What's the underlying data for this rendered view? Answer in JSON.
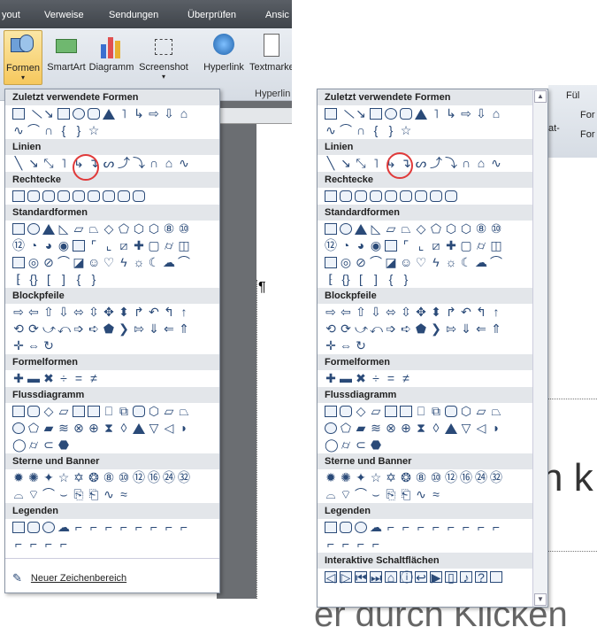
{
  "ribbon": {
    "tabs": [
      "yout",
      "Verweise",
      "Sendungen",
      "Überprüfen",
      "Ansic"
    ],
    "buttons": [
      "Formen",
      "SmartArt",
      "Diagramm",
      "Screenshot",
      "Hyperlink",
      "Textmarke"
    ],
    "group_label": "Hyperlin"
  },
  "left_panel": {
    "sections": [
      "Zuletzt verwendete Formen",
      "Linien",
      "Rechtecke",
      "Standardformen",
      "Blockpfeile",
      "Formelformen",
      "Flussdiagramm",
      "Sterne und Banner",
      "Legenden"
    ],
    "footer": "Neuer Zeichenbereich"
  },
  "right_panel": {
    "sections": [
      "Zuletzt verwendete Formen",
      "Linien",
      "Rechtecke",
      "Standardformen",
      "Blockpfeile",
      "Formelformen",
      "Flussdiagramm",
      "Sterne und Banner",
      "Legenden",
      "Interaktive Schaltflächen"
    ]
  },
  "background": {
    "right_ribbon": [
      "Fül",
      "For",
      "For"
    ],
    "partial_label": "at-",
    "big_text_1": "n k",
    "big_text_2": "er durch Klicken"
  },
  "pilcrow": "¶",
  "colors": {
    "accent": "#2a4a78",
    "highlight": "#e03a3a",
    "header_bg": "#e3e6ea"
  }
}
